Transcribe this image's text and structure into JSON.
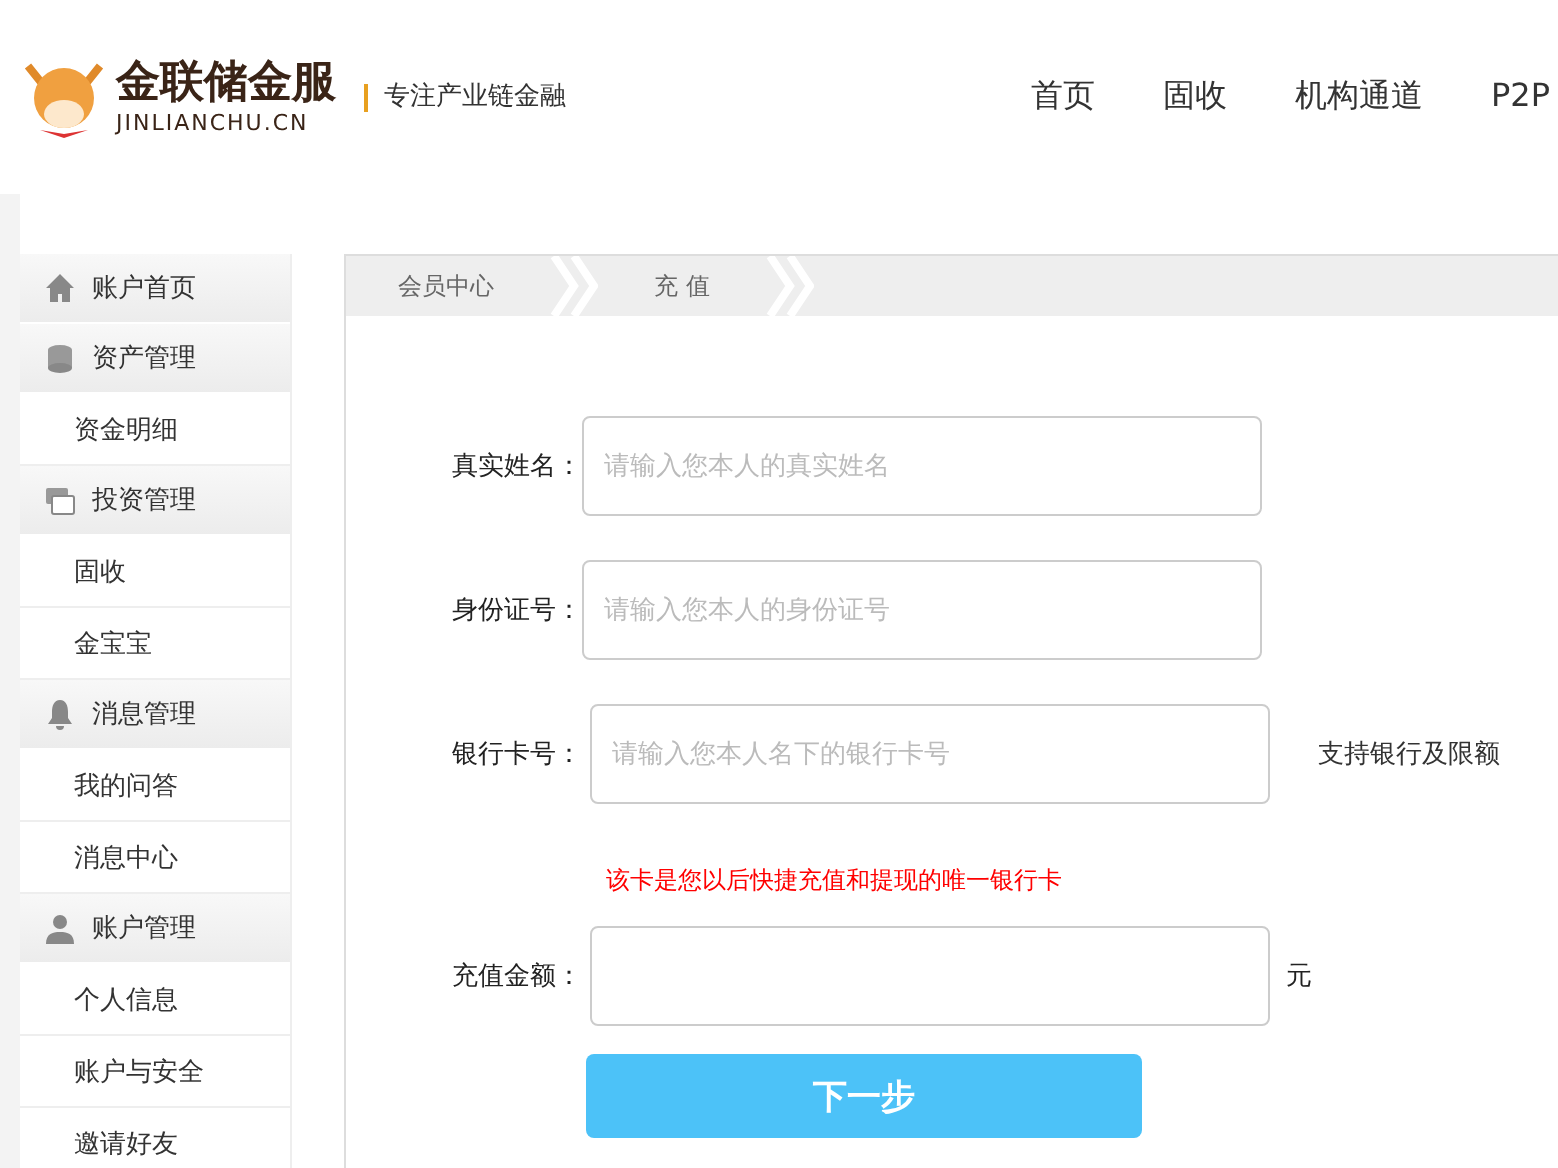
{
  "header": {
    "brand": "金联储金服",
    "domain": "JINLIANCHU.CN",
    "slogan": "专注产业链金融",
    "nav": [
      {
        "label": "首页"
      },
      {
        "label": "固收"
      },
      {
        "label": "机构通道"
      },
      {
        "label": "P2P"
      }
    ]
  },
  "sidebar": {
    "items": [
      {
        "kind": "group",
        "label": "账户首页"
      },
      {
        "kind": "group",
        "label": "资产管理"
      },
      {
        "kind": "link",
        "label": "资金明细"
      },
      {
        "kind": "group",
        "label": "投资管理"
      },
      {
        "kind": "link",
        "label": "固收"
      },
      {
        "kind": "link",
        "label": "金宝宝"
      },
      {
        "kind": "group",
        "label": "消息管理"
      },
      {
        "kind": "link",
        "label": "我的问答"
      },
      {
        "kind": "link",
        "label": "消息中心"
      },
      {
        "kind": "group",
        "label": "账户管理"
      },
      {
        "kind": "link",
        "label": "个人信息"
      },
      {
        "kind": "link",
        "label": "账户与安全"
      },
      {
        "kind": "link",
        "label": "邀请好友"
      }
    ]
  },
  "breadcrumb": [
    {
      "label": "会员中心"
    },
    {
      "label": "充 值"
    }
  ],
  "form": {
    "fields": [
      {
        "label": "真实姓名：",
        "placeholder": "请输入您本人的真实姓名"
      },
      {
        "label": "身份证号：",
        "placeholder": "请输入您本人的身份证号"
      },
      {
        "label": "银行卡号：",
        "placeholder": "请输入您本人名下的银行卡号",
        "side_link": "支持银行及限额",
        "note": "该卡是您以后快捷充值和提现的唯一银行卡"
      },
      {
        "label": "充值金额：",
        "unit": "元"
      }
    ],
    "submit": "下一步"
  }
}
